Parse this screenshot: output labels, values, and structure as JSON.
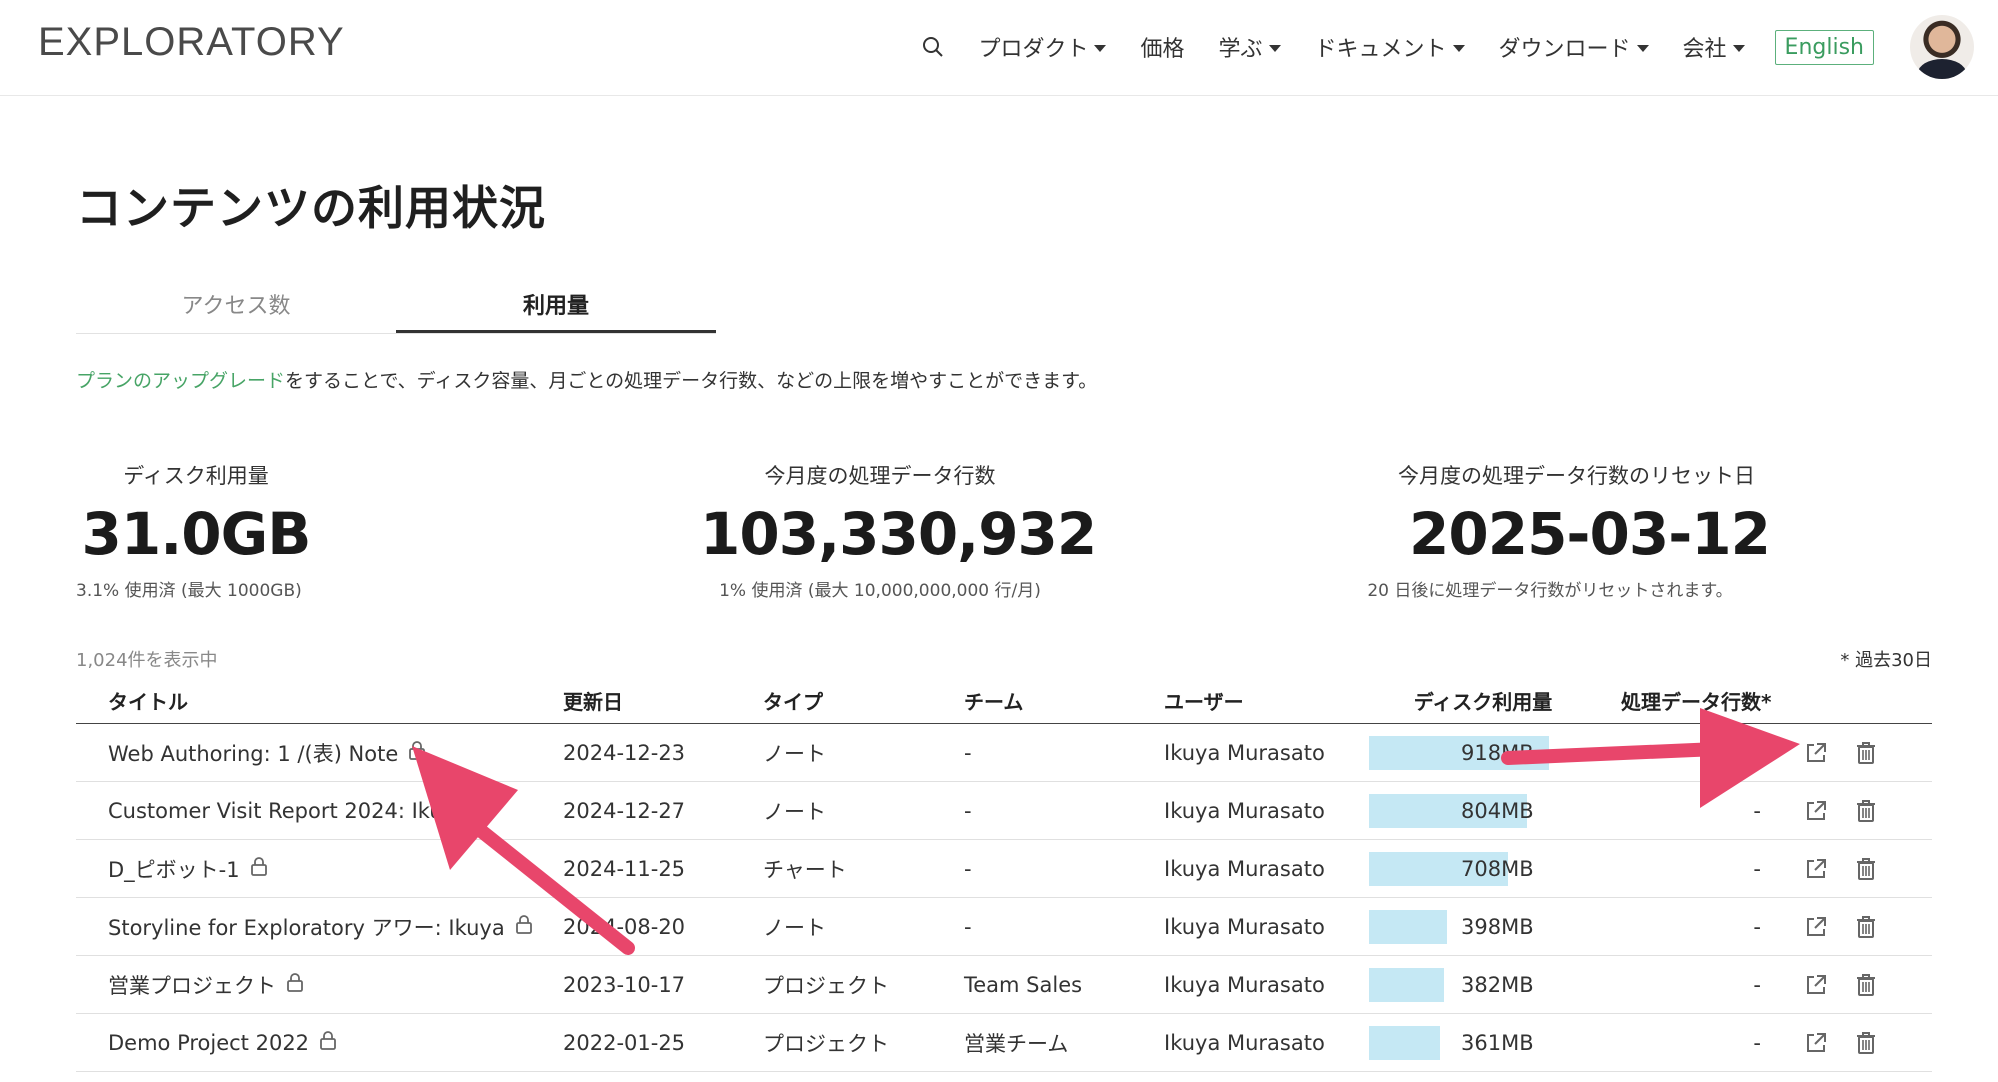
{
  "header": {
    "logo": "EXPLORATORY",
    "nav": [
      "プロダクト",
      "価格",
      "学ぶ",
      "ドキュメント",
      "ダウンロード",
      "会社"
    ],
    "nav_has_caret": [
      true,
      false,
      true,
      true,
      true,
      true
    ],
    "language_button": "English"
  },
  "page": {
    "title": "コンテンツの利用状況",
    "tabs": [
      {
        "label": "アクセス数",
        "active": false
      },
      {
        "label": "利用量",
        "active": true
      }
    ],
    "upgrade_link": "プランのアップグレード",
    "upgrade_text": "をすることで、ディスク容量、月ごとの処理データ行数、などの上限を増やすことができます。"
  },
  "stats": {
    "disk": {
      "label": "ディスク利用量",
      "value": "31.0GB",
      "sub": "3.1% 使用済 (最大 1000GB)"
    },
    "rows": {
      "label": "今月度の処理データ行数",
      "value": "103,330,932",
      "sub": "1% 使用済 (最大 10,000,000,000 行/月)"
    },
    "reset": {
      "label": "今月度の処理データ行数のリセット日",
      "value": "2025-03-12",
      "sub": "20 日後に処理データ行数がリセットされます。"
    }
  },
  "list": {
    "count_text": "1,024件を表示中",
    "period_text": "* 過去30日",
    "headers": [
      "タイトル",
      "更新日",
      "タイプ",
      "チーム",
      "ユーザー",
      "ディスク利用量",
      "処理データ行数*"
    ],
    "rows": [
      {
        "title": "Web Authoring: 1 /(表) Note",
        "date": "2024-12-23",
        "type": "ノート",
        "team": "-",
        "user": "Ikuya Murasato",
        "disk": "918MB",
        "disk_fraction": 1.0,
        "rows": ""
      },
      {
        "title": "Customer Visit Report 2024: Iku",
        "date": "2024-12-27",
        "type": "ノート",
        "team": "-",
        "user": "Ikuya Murasato",
        "disk": "804MB",
        "disk_fraction": 0.876,
        "rows": "-"
      },
      {
        "title": "D_ピボット-1",
        "date": "2024-11-25",
        "type": "チャート",
        "team": "-",
        "user": "Ikuya Murasato",
        "disk": "708MB",
        "disk_fraction": 0.771,
        "rows": "-"
      },
      {
        "title": "Storyline for Exploratory アワー: Ikuya",
        "date": "2024-08-20",
        "type": "ノート",
        "team": "-",
        "user": "Ikuya Murasato",
        "disk": "398MB",
        "disk_fraction": 0.434,
        "rows": "-"
      },
      {
        "title": "営業プロジェクト",
        "date": "2023-10-17",
        "type": "プロジェクト",
        "team": "Team Sales",
        "user": "Ikuya Murasato",
        "disk": "382MB",
        "disk_fraction": 0.416,
        "rows": "-"
      },
      {
        "title": "Demo Project 2022",
        "date": "2022-01-25",
        "type": "プロジェクト",
        "team": "営業チーム",
        "user": "Ikuya Murasato",
        "disk": "361MB",
        "disk_fraction": 0.393,
        "rows": "-"
      }
    ]
  },
  "colors": {
    "link_green": "#47a466",
    "bar_blue": "#c5e8f4",
    "annotation_arrow": "#e8466b"
  }
}
